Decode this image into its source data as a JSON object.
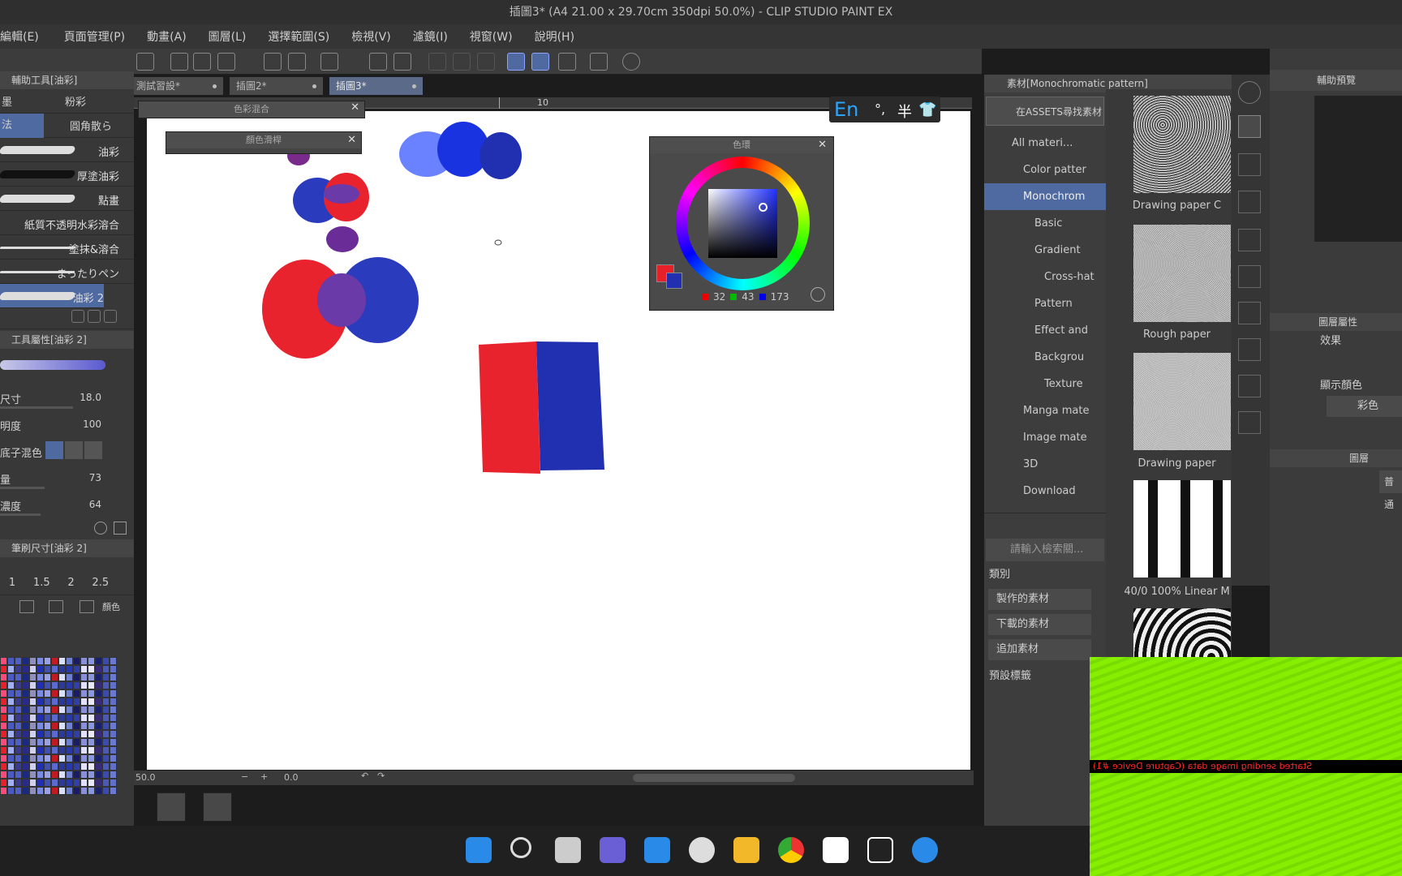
{
  "window": {
    "title": "插圖3* (A4 21.00 x 29.70cm 350dpi 50.0%)  - CLIP STUDIO PAINT EX"
  },
  "menu": [
    "編輯(E)",
    "頁面管理(P)",
    "動畫(A)",
    "圖層(L)",
    "選擇範圍(S)",
    "檢視(V)",
    "濾鏡(I)",
    "視窗(W)",
    "說明(H)"
  ],
  "tabs": [
    {
      "label": "測試習設*",
      "active": false
    },
    {
      "label": "插圖2*",
      "active": false
    },
    {
      "label": "插圖3*",
      "active": true
    }
  ],
  "ruler_mark": "10",
  "ime": {
    "lang": "En",
    "punct": "°,",
    "width": "半"
  },
  "sub_tool": {
    "title": "輔助工具[油彩]",
    "group_a": "墨",
    "group_b": "粉彩",
    "group_c": "法",
    "group_d": "圓角散ら",
    "brushes": [
      "油彩",
      "厚塗油彩",
      "點畫",
      "紙質不透明水彩溶合",
      "塗抹&溶合",
      "まったりペン",
      "油彩 2"
    ]
  },
  "tool_property": {
    "title": "工具屬性[油彩 2]",
    "rows": [
      {
        "key": "尺寸",
        "value": "18.0"
      },
      {
        "key": "明度",
        "value": "100"
      },
      {
        "key": "底子混色",
        "value": ""
      },
      {
        "key": "量",
        "value": "73"
      },
      {
        "key": "濃度",
        "value": "64"
      }
    ]
  },
  "brush_size": {
    "title": "筆刷尺寸[油彩 2]",
    "values": [
      "1",
      "1.5",
      "2",
      "2.5"
    ]
  },
  "color_set_label": "顏色",
  "floating_panels": {
    "history": "色彩混合",
    "color_mix": "顏色滑桿",
    "color_wheel": "色環"
  },
  "color_wheel": {
    "r": "32",
    "g": "43",
    "b": "173",
    "main_color": "#e8202a",
    "sub_color": "#2030b0"
  },
  "status_bar": {
    "zoom": "50.0",
    "angle": "0.0"
  },
  "material_panel": {
    "title": "素材[Monochromatic pattern]",
    "assets_button": "在ASSETS尋找素材",
    "tree": [
      {
        "label": "All materi...",
        "selected": false
      },
      {
        "label": "Color patter",
        "selected": false
      },
      {
        "label": "Monochrom",
        "selected": true
      },
      {
        "label": "Basic",
        "selected": false
      },
      {
        "label": "Gradient",
        "selected": false
      },
      {
        "label": "Cross-hat",
        "selected": false
      },
      {
        "label": "Pattern",
        "selected": false
      },
      {
        "label": "Effect and",
        "selected": false
      },
      {
        "label": "Backgrou",
        "selected": false
      },
      {
        "label": "Texture",
        "selected": false
      },
      {
        "label": "Manga mate",
        "selected": false
      },
      {
        "label": "Image mate",
        "selected": false
      },
      {
        "label": "3D",
        "selected": false
      },
      {
        "label": "Download",
        "selected": false
      }
    ],
    "search_placeholder": "請輸入檢索關...",
    "category_label": "類別",
    "category_buttons": [
      "製作的素材",
      "下載的素材",
      "追加素材"
    ],
    "preset_label": "預設標籤",
    "thumbnails": [
      "Drawing paper C",
      "Rough paper",
      "Drawing paper",
      "40/0 100% Linear M"
    ]
  },
  "right_strip": {
    "nav_title": "輔助預覽",
    "layer_prop": "圖層屬性",
    "effect": "效果",
    "display_color": "顯示顏色",
    "color_mode": "彩色",
    "layers_title": "圖層",
    "blend": "普通"
  },
  "capture_overlay": "Started sending image data (Capture Device #1)",
  "taskbar": [
    "start-icon",
    "search-icon",
    "task-view-icon",
    "teams-icon",
    "store-icon",
    "alien-icon",
    "explorer-icon",
    "chrome-icon",
    "csp-icon",
    "qq-icon",
    "app-icon"
  ]
}
